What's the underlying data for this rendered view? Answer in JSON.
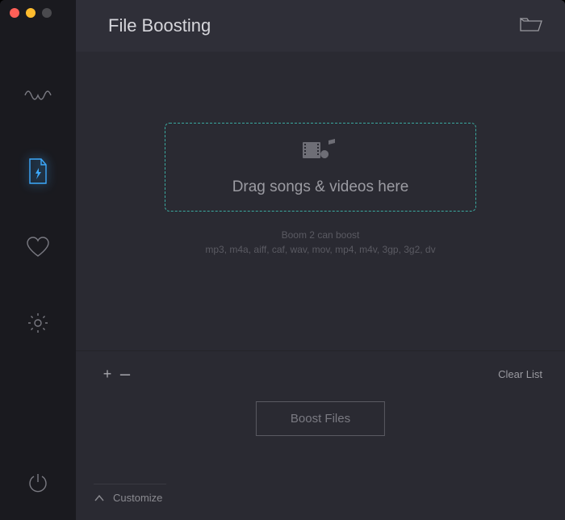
{
  "header": {
    "title": "File Boosting"
  },
  "dropzone": {
    "text": "Drag songs & videos here"
  },
  "info": {
    "line1": "Boom 2 can boost",
    "line2": "mp3, m4a, aiff, caf, wav, mov, mp4, m4v, 3gp, 3g2, dv"
  },
  "footer": {
    "plus": "+",
    "minus": "–",
    "clear_list": "Clear List",
    "boost_button": "Boost Files",
    "customize": "Customize"
  }
}
